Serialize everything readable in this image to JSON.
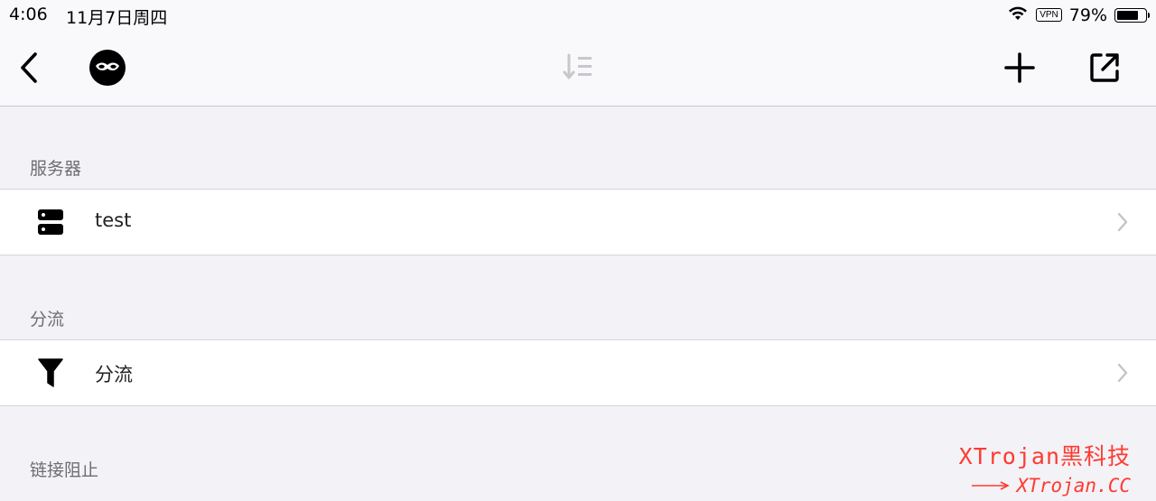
{
  "status_bar": {
    "time": "4:06",
    "date": "11月7日周四",
    "vpn": "VPN",
    "battery_text": "79%",
    "battery_level": 0.79
  },
  "navbar": {
    "back_icon": "chevron-left-icon",
    "mask_icon": "mask-icon",
    "sort_icon": "sort-icon",
    "add_icon": "plus-icon",
    "share_icon": "share-icon"
  },
  "sections": [
    {
      "header": "服务器",
      "row": {
        "label": "test",
        "icon": "server-icon"
      }
    },
    {
      "header": "分流",
      "row": {
        "label": "分流",
        "icon": "filter-icon"
      }
    },
    {
      "header": "链接阻止"
    }
  ],
  "watermark": {
    "line1": "XTrojan黑科技",
    "line2": "XTrojan.CC",
    "color": "#ff3b30"
  }
}
